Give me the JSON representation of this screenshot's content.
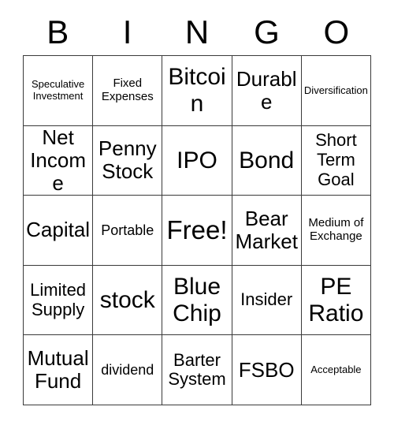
{
  "card": {
    "title": "BINGO",
    "header_letters": [
      "B",
      "I",
      "N",
      "G",
      "O"
    ],
    "grid_size": "5x5",
    "free_space": "Free!",
    "colors": {
      "background": "#ffffff",
      "text": "#000000",
      "border": "#3a3a3a"
    },
    "rows": [
      [
        {
          "label": "Speculative Investment",
          "size": "xs"
        },
        {
          "label": "Fixed Expenses",
          "size": "sm"
        },
        {
          "label": "Bitcoin",
          "size": "xxl"
        },
        {
          "label": "Durable",
          "size": "xl"
        },
        {
          "label": "Diversification",
          "size": "xs"
        }
      ],
      [
        {
          "label": "Net Income",
          "size": "xl"
        },
        {
          "label": "Penny Stock",
          "size": "xl"
        },
        {
          "label": "IPO",
          "size": "xxl"
        },
        {
          "label": "Bond",
          "size": "xxl"
        },
        {
          "label": "Short Term Goal",
          "size": "lg"
        }
      ],
      [
        {
          "label": "Capital",
          "size": "xl"
        },
        {
          "label": "Portable",
          "size": "md"
        },
        {
          "label": "Free!",
          "size": "free"
        },
        {
          "label": "Bear Market",
          "size": "xl"
        },
        {
          "label": "Medium of Exchange",
          "size": "sm"
        }
      ],
      [
        {
          "label": "Limited Supply",
          "size": "lg"
        },
        {
          "label": "stock",
          "size": "xxl"
        },
        {
          "label": "Blue Chip",
          "size": "xxl"
        },
        {
          "label": "Insider",
          "size": "lg"
        },
        {
          "label": "PE Ratio",
          "size": "xxl"
        }
      ],
      [
        {
          "label": "Mutual Fund",
          "size": "xl"
        },
        {
          "label": "dividend",
          "size": "md"
        },
        {
          "label": "Barter System",
          "size": "lg"
        },
        {
          "label": "FSBO",
          "size": "xl"
        },
        {
          "label": "Acceptable",
          "size": "xs"
        }
      ]
    ]
  }
}
